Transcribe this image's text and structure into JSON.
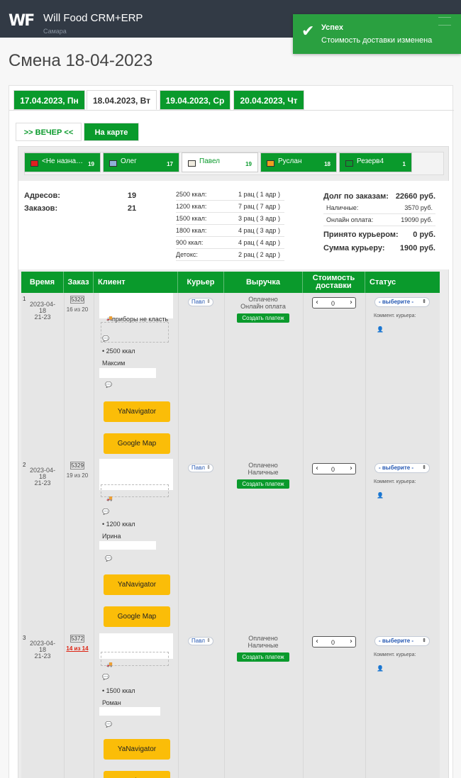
{
  "app": {
    "logo": "WF",
    "title": "Will Food CRM+ERP",
    "city": "Самара"
  },
  "toast": {
    "title": "Успех",
    "message": "Стоимость доставки изменена"
  },
  "page_title": "Смена 18-04-2023",
  "date_tabs": [
    "17.04.2023, Пн",
    "18.04.2023, Вт",
    "19.04.2023, Ср",
    "20.04.2023, Чт"
  ],
  "active_date_tab": 1,
  "sub_tabs": {
    "evening": ">> ВЕЧЕР <<",
    "map": "На карте"
  },
  "couriers": [
    {
      "name": "<Не назна…",
      "count": "19",
      "color": "#e02020"
    },
    {
      "name": "Олег",
      "count": "17",
      "color": "#8fb0d8"
    },
    {
      "name": "Павел",
      "count": "19",
      "color": "#f0ece0",
      "selected": true
    },
    {
      "name": "Руслан",
      "count": "18",
      "color": "#f0a020"
    },
    {
      "name": "Резерв4",
      "count": "1",
      "color": "#0a9a2c"
    }
  ],
  "stats": {
    "addresses_label": "Адресов:",
    "addresses": "19",
    "orders_label": "Заказов:",
    "orders": "21",
    "kcal": [
      {
        "label": "2500 ккал:",
        "value": "1 рац ( 1 адр )"
      },
      {
        "label": "1200 ккал:",
        "value": "7 рац ( 7 адр )"
      },
      {
        "label": "1500 ккал:",
        "value": "3 рац ( 3 адр )"
      },
      {
        "label": "1800 ккал:",
        "value": "4 рац ( 3 адр )"
      },
      {
        "label": "900 ккал:",
        "value": "4 рац ( 4 адр )"
      },
      {
        "label": "Детокс:",
        "value": "2 рац ( 2 адр )"
      }
    ],
    "debt_label": "Долг по заказам:",
    "debt": "22660 руб.",
    "cash_label": "Наличные:",
    "cash": "3570 руб.",
    "online_label": "Онлайн оплата:",
    "online": "19090 руб.",
    "accepted_label": "Принято курьером:",
    "accepted": "0 руб.",
    "courier_sum_label": "Сумма курьеру:",
    "courier_sum": "1900 руб."
  },
  "table_headers": {
    "time": "Время",
    "order": "Заказ",
    "client": "Клиент",
    "courier": "Курьер",
    "revenue": "Выручка",
    "delivery_cost": "Стоимость доставки",
    "status": "Статус"
  },
  "orders": [
    {
      "num": "1",
      "date": "2023-04-18",
      "time": "21-23",
      "id": "5320",
      "of": "16 из 20",
      "note": "приборы не класть",
      "kcal": "• 2500 ккал",
      "name": "Максим",
      "courier": "Павл",
      "paid": "Оплачено",
      "payment": "Онлайн оплата",
      "create": "Создать платеж",
      "cost": "0",
      "status": "- выберите -",
      "comment_label": "Коммент. курьера:",
      "ya": "YaNavigator",
      "gmap": "Google Map"
    },
    {
      "num": "2",
      "date": "2023-04-18",
      "time": "21-23",
      "id": "5329",
      "of": "19 из 20",
      "note": "",
      "kcal": "• 1200 ккал",
      "name": "Ирина",
      "courier": "Павл",
      "paid": "Оплачено",
      "payment": "Наличные",
      "create": "Создать платеж",
      "cost": "0",
      "status": "- выберите -",
      "comment_label": "Коммент. курьера:",
      "ya": "YaNavigator",
      "gmap": "Google Map"
    },
    {
      "num": "3",
      "date": "2023-04-18",
      "time": "21-23",
      "id": "5372",
      "of": "14 из 14",
      "note": "",
      "kcal": "• 1500 ккал",
      "name": "Роман",
      "courier": "Павл",
      "paid": "Оплачено",
      "payment": "Наличные",
      "create": "Создать платеж",
      "cost": "0",
      "status": "- выберите -",
      "comment_label": "Коммент. курьера:",
      "ya": "YaNavigator",
      "gmap": "Google Map"
    }
  ],
  "icons": {
    "truck": "truck-icon",
    "comment": "comment-icon",
    "user": "user-icon",
    "check": "check-icon"
  }
}
